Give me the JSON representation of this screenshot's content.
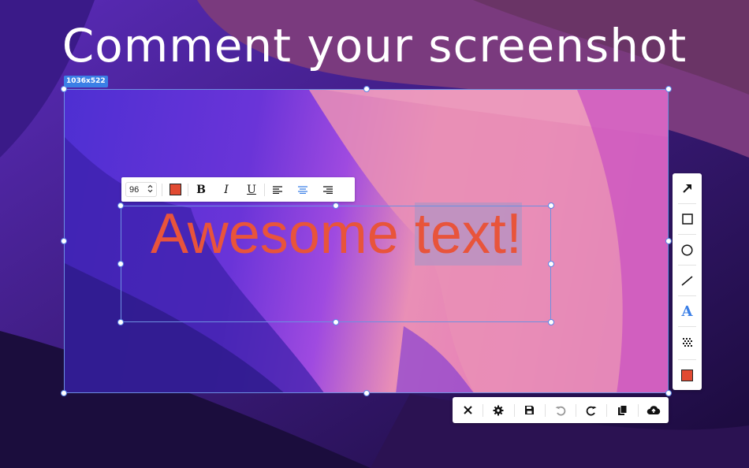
{
  "headline": "Comment your screenshot",
  "selection": {
    "size_label": "1036x522"
  },
  "annotation": {
    "text_part1": "Awesome ",
    "text_part2": "text!",
    "color": "#e8543b"
  },
  "format_toolbar": {
    "font_size": "96",
    "bold_label": "B",
    "italic_label": "I",
    "underline_label": "U",
    "text_color": "#e14a32",
    "alignment_selected": "center"
  },
  "tool_palette": {
    "tools": [
      "arrow-icon",
      "rectangle-icon",
      "ellipse-icon",
      "line-icon",
      "text-icon",
      "pixelate-icon",
      "color-swatch"
    ],
    "selected": "text-icon",
    "text_tool_label": "A",
    "accent": "#3b7fe6"
  },
  "action_bar": {
    "buttons": [
      "close-icon",
      "settings-icon",
      "save-icon",
      "undo-icon",
      "redo-icon",
      "copy-icon",
      "upload-cloud-icon"
    ]
  }
}
